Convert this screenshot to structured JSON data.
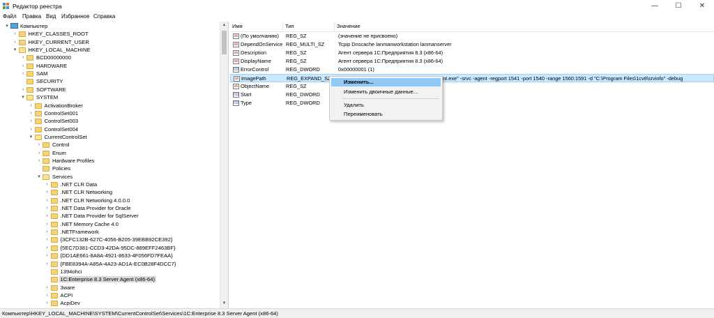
{
  "window": {
    "title": "Редактор реестра",
    "minimize": "—",
    "maximize": "☐",
    "close": "✕"
  },
  "menu": [
    "Файл",
    "Правка",
    "Вид",
    "Избранное",
    "Справка"
  ],
  "tree": [
    {
      "label": "Компьютер",
      "depth": 0,
      "expander": "▾",
      "icon": "computer-icon"
    },
    {
      "label": "HKEY_CLASSES_ROOT",
      "depth": 1,
      "expander": "›",
      "icon": "folder-icon"
    },
    {
      "label": "HKEY_CURRENT_USER",
      "depth": 1,
      "expander": "›",
      "icon": "folder-icon"
    },
    {
      "label": "HKEY_LOCAL_MACHINE",
      "depth": 1,
      "expander": "▾",
      "icon": "folder-open-icon"
    },
    {
      "label": "BCD00000000",
      "depth": 2,
      "expander": "›",
      "icon": "folder-icon"
    },
    {
      "label": "HARDWARE",
      "depth": 2,
      "expander": "›",
      "icon": "folder-icon"
    },
    {
      "label": "SAM",
      "depth": 2,
      "expander": "›",
      "icon": "folder-icon"
    },
    {
      "label": "SECURITY",
      "depth": 2,
      "expander": "",
      "icon": "folder-icon"
    },
    {
      "label": "SOFTWARE",
      "depth": 2,
      "expander": "›",
      "icon": "folder-icon"
    },
    {
      "label": "SYSTEM",
      "depth": 2,
      "expander": "▾",
      "icon": "folder-open-icon"
    },
    {
      "label": "ActivationBroker",
      "depth": 3,
      "expander": "›",
      "icon": "folder-icon"
    },
    {
      "label": "ControlSet001",
      "depth": 3,
      "expander": "›",
      "icon": "folder-icon"
    },
    {
      "label": "ControlSet003",
      "depth": 3,
      "expander": "›",
      "icon": "folder-icon"
    },
    {
      "label": "ControlSet004",
      "depth": 3,
      "expander": "›",
      "icon": "folder-icon"
    },
    {
      "label": "CurrentControlSet",
      "depth": 3,
      "expander": "▾",
      "icon": "folder-open-icon"
    },
    {
      "label": "Control",
      "depth": 4,
      "expander": "›",
      "icon": "folder-icon"
    },
    {
      "label": "Enum",
      "depth": 4,
      "expander": "›",
      "icon": "folder-icon"
    },
    {
      "label": "Hardware Profiles",
      "depth": 4,
      "expander": "›",
      "icon": "folder-icon"
    },
    {
      "label": "Policies",
      "depth": 4,
      "expander": "",
      "icon": "folder-icon"
    },
    {
      "label": "Services",
      "depth": 4,
      "expander": "▾",
      "icon": "folder-open-icon"
    },
    {
      "label": ".NET CLR Data",
      "depth": 5,
      "expander": "›",
      "icon": "folder-icon"
    },
    {
      "label": ".NET CLR Networking",
      "depth": 5,
      "expander": "›",
      "icon": "folder-icon"
    },
    {
      "label": ".NET CLR Networking 4.0.0.0",
      "depth": 5,
      "expander": "›",
      "icon": "folder-icon"
    },
    {
      "label": ".NET Data Provider for Oracle",
      "depth": 5,
      "expander": "›",
      "icon": "folder-icon"
    },
    {
      "label": ".NET Data Provider for SqlServer",
      "depth": 5,
      "expander": "›",
      "icon": "folder-icon"
    },
    {
      "label": ".NET Memory Cache 4.0",
      "depth": 5,
      "expander": "›",
      "icon": "folder-icon"
    },
    {
      "label": ".NETFramework",
      "depth": 5,
      "expander": "›",
      "icon": "folder-icon"
    },
    {
      "label": "{3CFC132B-627C-4056-B205-39EBB92CE392}",
      "depth": 5,
      "expander": "›",
      "icon": "folder-icon"
    },
    {
      "label": "{5EC7D381-CCD3-42DA-95DC-889EFF2463BF}",
      "depth": 5,
      "expander": "›",
      "icon": "folder-icon"
    },
    {
      "label": "{DD1AE661-8A8A-4921-8633-4F056FD7FEAA}",
      "depth": 5,
      "expander": "›",
      "icon": "folder-icon"
    },
    {
      "label": "{FBE8394A-A85A-4A23-AD1A-EC0B28F4DCC7}",
      "depth": 5,
      "expander": "›",
      "icon": "folder-icon"
    },
    {
      "label": "1394ohci",
      "depth": 5,
      "expander": "",
      "icon": "folder-icon"
    },
    {
      "label": "1C:Enterprise 8.3 Server Agent (x86-64)",
      "depth": 5,
      "expander": "",
      "icon": "folder-icon",
      "selected": true
    },
    {
      "label": "3ware",
      "depth": 5,
      "expander": "›",
      "icon": "folder-icon"
    },
    {
      "label": "ACPI",
      "depth": 5,
      "expander": "›",
      "icon": "folder-icon"
    },
    {
      "label": "AcpiDev",
      "depth": 5,
      "expander": "›",
      "icon": "folder-icon"
    }
  ],
  "columns": {
    "name": "Имя",
    "type": "Тип",
    "data": "Значение"
  },
  "values": [
    {
      "name": "(По умолчанию)",
      "type": "REG_SZ",
      "data": "(значение не присвоено)",
      "icon": "ab"
    },
    {
      "name": "DependOnService",
      "type": "REG_MULTI_SZ",
      "data": "Tcpip Dnscache lanmanworkstation lanmanserver",
      "icon": "ab"
    },
    {
      "name": "Description",
      "type": "REG_SZ",
      "data": "Агент сервера 1С:Предприятия 8.3 (x86-64)",
      "icon": "ab"
    },
    {
      "name": "DisplayName",
      "type": "REG_SZ",
      "data": "Агент сервера 1С:Предприятия 8.3 (x86-64)",
      "icon": "ab"
    },
    {
      "name": "ErrorControl",
      "type": "REG_DWORD",
      "data": "0x00000001 (1)",
      "icon": "bin"
    },
    {
      "name": "ImagePath",
      "type": "REG_EXPAND_SZ",
      "data": "nt.exe\" -srvc -agent -regport 1541 -port 1540 -range 1560:1591 -d \"C:\\Program Files\\1cv8\\srvinfo\" -debug",
      "icon": "ab",
      "selected": true
    },
    {
      "name": "ObjectName",
      "type": "REG_SZ",
      "data": "",
      "icon": "ab"
    },
    {
      "name": "Start",
      "type": "REG_DWORD",
      "data": "",
      "icon": "bin"
    },
    {
      "name": "Type",
      "type": "REG_DWORD",
      "data": "",
      "icon": "bin"
    }
  ],
  "context_menu": {
    "modify": "Изменить...",
    "modify_binary": "Изменить двоичные данные...",
    "delete": "Удалить",
    "rename": "Переименовать"
  },
  "status": "Компьютер\\HKEY_LOCAL_MACHINE\\SYSTEM\\CurrentControlSet\\Services\\1C:Enterprise 8.3 Server Agent (x86-64)"
}
